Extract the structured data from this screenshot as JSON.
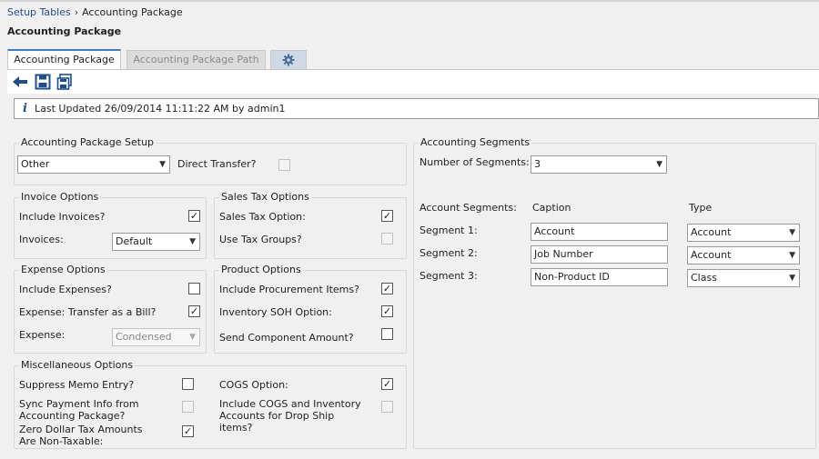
{
  "breadcrumb": {
    "root": "Setup Tables",
    "separator": "›",
    "current": "Accounting Package"
  },
  "page_title": "Accounting Package",
  "tabs": [
    {
      "label": "Accounting Package",
      "active": true
    },
    {
      "label": "Accounting Package Path",
      "active": false
    },
    {
      "icon": "gear-icon"
    }
  ],
  "toolbar": {
    "icons": [
      "back-arrow-icon",
      "save-icon",
      "save-and-close-icon"
    ]
  },
  "status": {
    "icon": "info-icon",
    "glyph": "i",
    "text": "Last Updated 26/09/2014 11:11:22 AM by admin1"
  },
  "setup": {
    "legend": "Accounting Package Setup",
    "package_value": "Other",
    "direct_transfer_label": "Direct Transfer?",
    "direct_transfer_checked": false
  },
  "invoice": {
    "legend": "Invoice Options",
    "include_label": "Include Invoices?",
    "include_checked": true,
    "invoices_label": "Invoices:",
    "invoices_value": "Default"
  },
  "sales_tax": {
    "legend": "Sales Tax Options",
    "option_label": "Sales Tax Option:",
    "option_checked": true,
    "groups_label": "Use Tax Groups?",
    "groups_checked": false
  },
  "expense": {
    "legend": "Expense Options",
    "include_label": "Include Expenses?",
    "include_checked": false,
    "bill_label": "Expense: Transfer as a Bill?",
    "bill_checked": true,
    "expense_label": "Expense:",
    "expense_value": "Condensed"
  },
  "product": {
    "legend": "Product Options",
    "procurement_label": "Include Procurement Items?",
    "procurement_checked": true,
    "soh_label": "Inventory SOH Option:",
    "soh_checked": true,
    "component_label": "Send Component Amount?",
    "component_checked": false
  },
  "misc": {
    "legend": "Miscellaneous Options",
    "memo_label": "Suppress Memo Entry?",
    "memo_checked": false,
    "cogs_label": "COGS Option:",
    "cogs_checked": true,
    "sync_label": "Sync Payment Info from Accounting Package?",
    "sync_checked": false,
    "dropship_label": "Include COGS and Inventory Accounts for Drop Ship items?",
    "dropship_checked": false,
    "zero_label": "Zero Dollar Tax Amounts Are Non-Taxable:",
    "zero_checked": true
  },
  "segments": {
    "legend": "Accounting Segments",
    "count_label": "Number of Segments:",
    "count_value": "3",
    "header_label": "Account Segments:",
    "header_caption": "Caption",
    "header_type": "Type",
    "rows": [
      {
        "label": "Segment 1:",
        "caption": "Account",
        "type": "Account"
      },
      {
        "label": "Segment 2:",
        "caption": "Job Number",
        "type": "Account"
      },
      {
        "label": "Segment 3:",
        "caption": "Non-Product ID",
        "type": "Class"
      }
    ]
  },
  "check_glyph": "✓",
  "dropdown_glyph": "▼",
  "colors": {
    "accent": "#3c7fc1",
    "link": "#1f4e8c",
    "background": "#f0f0f0"
  }
}
